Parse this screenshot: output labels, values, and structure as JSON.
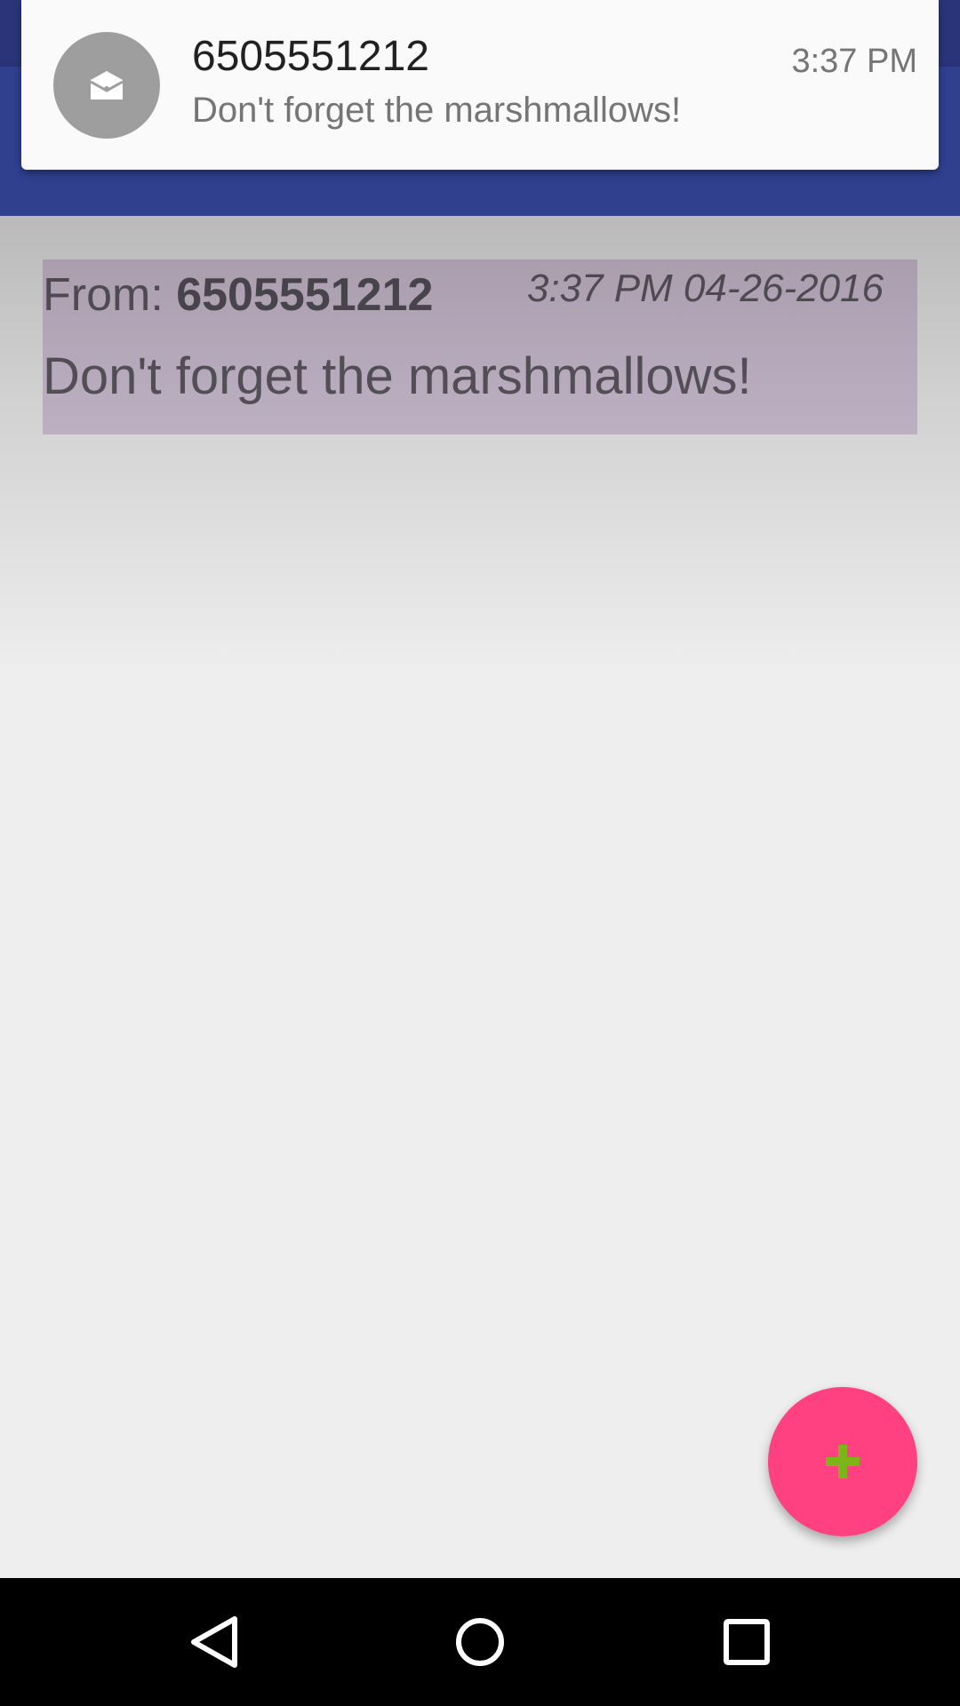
{
  "notification": {
    "title": "6505551212",
    "text": "Don't forget the marshmallows!",
    "time": "3:37 PM",
    "icon": "envelope-open-icon"
  },
  "message": {
    "from_label": "From: ",
    "from_number": "6505551212",
    "timestamp": "3:37 PM 04-26-2016",
    "body": "Don't forget the marshmallows!"
  },
  "fab": {
    "icon": "plus-icon",
    "color": "#ff4081",
    "icon_color": "#7cb518"
  },
  "nav": {
    "back_icon": "back-triangle-icon",
    "home_icon": "home-circle-icon",
    "recents_icon": "recents-square-icon"
  },
  "colors": {
    "primary": "#303f8e",
    "primary_dark": "#2a3478",
    "card_background": "#d3c4d9",
    "accent": "#ff4081"
  }
}
